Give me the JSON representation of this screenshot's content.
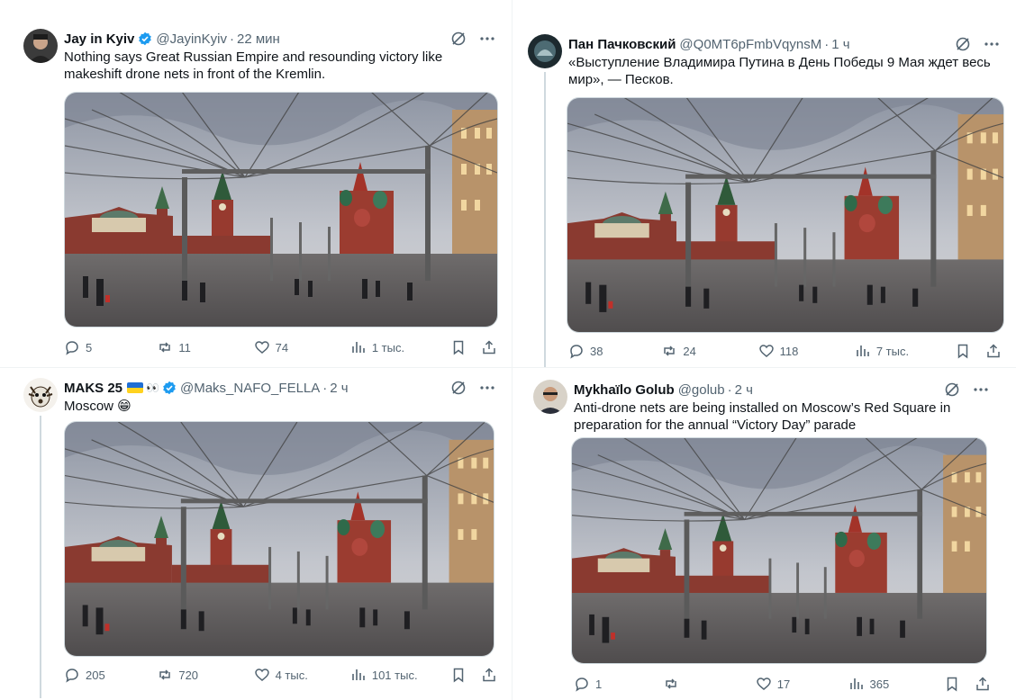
{
  "tweets": [
    {
      "author": {
        "name": "Jay in Kyiv",
        "handle": "@JayinKyiv",
        "verified": true
      },
      "time": "22 мин",
      "text": "Nothing says Great Russian Empire and  resounding victory like makeshift drone nets in front of the Kremlin.",
      "stats": {
        "replies": "5",
        "reposts": "11",
        "likes": "74",
        "views": "1 тыс."
      }
    },
    {
      "author": {
        "name": "Пан Пачковский",
        "handle": "@Q0MT6pFmbVqynsM",
        "verified": false
      },
      "time": "1 ч",
      "text": "«Выступление Владимира Путина в День Победы 9 Мая ждет весь мир», — Песков.",
      "stats": {
        "replies": "38",
        "reposts": "24",
        "likes": "118",
        "views": "7 тыс."
      }
    },
    {
      "author": {
        "name": "MAKS 25",
        "handle": "@Maks_NAFO_FELLA",
        "verified": true,
        "emoji": "👀"
      },
      "time": "2 ч",
      "text": "Moscow 😁",
      "stats": {
        "replies": "205",
        "reposts": "720",
        "likes": "4 тыс.",
        "views": "101 тыс."
      }
    },
    {
      "author": {
        "name": "Mykhaïlo Golub",
        "handle": "@golub",
        "verified": false
      },
      "time": "2 ч",
      "text": "Anti-drone nets are being installed on Moscow’s Red Square in preparation for the annual “Victory Day” parade",
      "stats": {
        "replies": "1",
        "reposts": "",
        "likes": "17",
        "views": "365"
      }
    }
  ],
  "dot": "·",
  "colors": {
    "verified": "#1d9bf0",
    "muted": "#536471",
    "text": "#0f1419"
  },
  "icons": [
    "verified-icon",
    "grok-icon",
    "more-icon",
    "reply-icon",
    "retweet-icon",
    "like-icon",
    "views-icon",
    "bookmark-icon",
    "share-icon"
  ]
}
